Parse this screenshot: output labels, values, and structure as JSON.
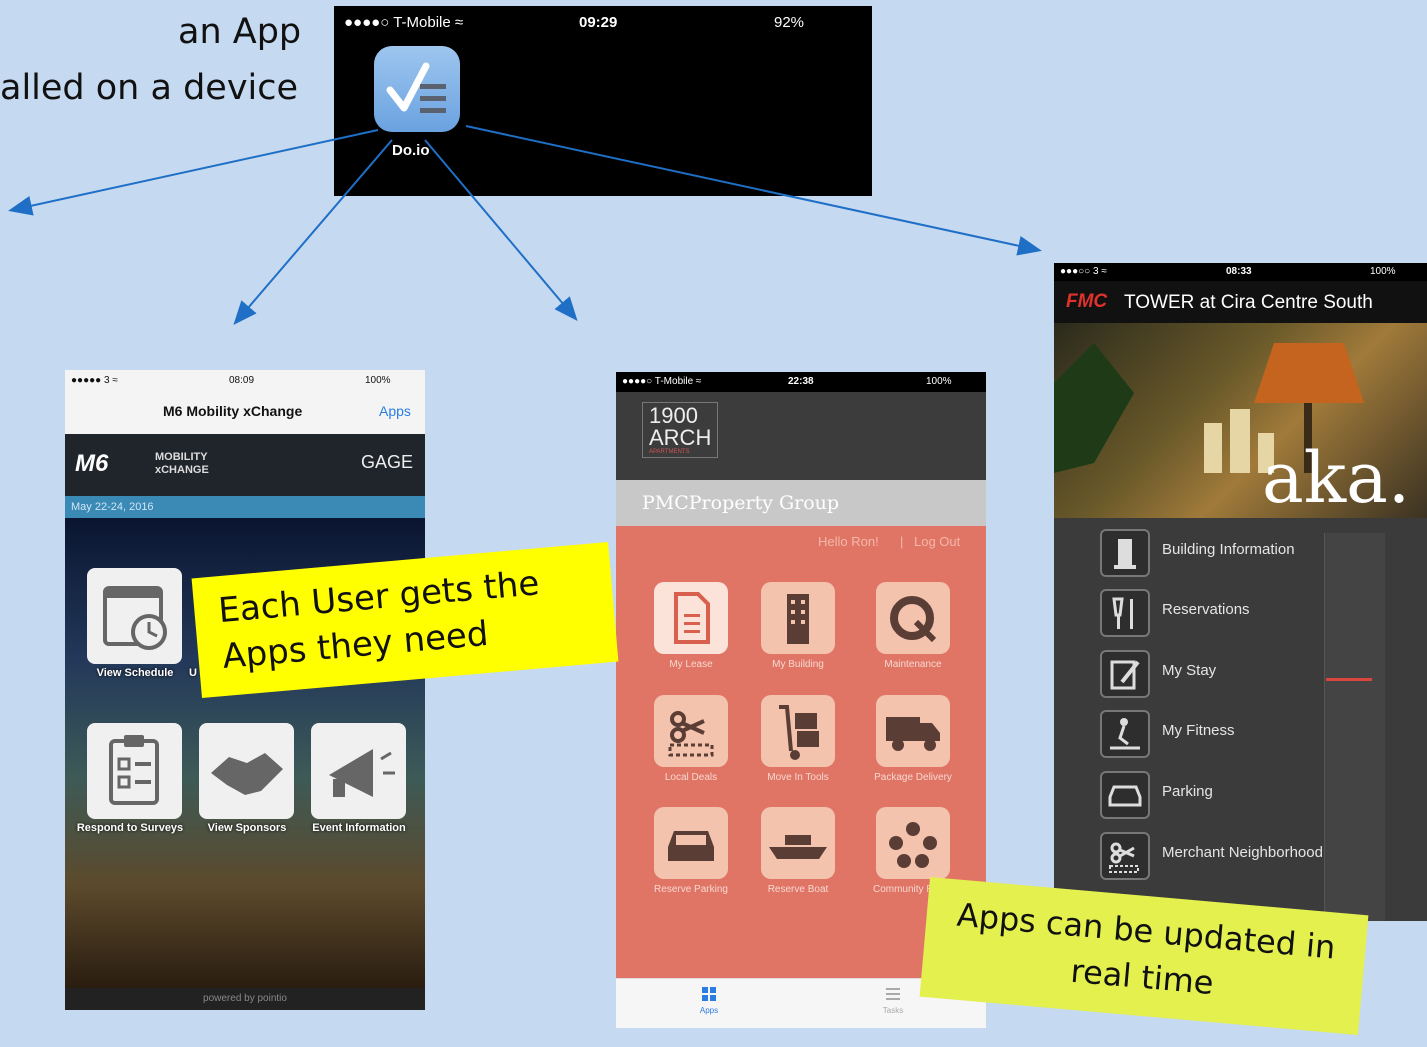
{
  "caption": {
    "line1": "an App",
    "line2": "alled on a device"
  },
  "top_phone": {
    "carrier": "●●●●○ T-Mobile ≈",
    "time": "09:29",
    "battery": "92%",
    "app_label": "Do.io"
  },
  "phone1": {
    "status_left": "●●●●● 3 ≈",
    "status_time": "08:09",
    "status_right": "100%",
    "nav_title": "M6 Mobility xChange",
    "nav_apps": "Apps",
    "brand": "M6",
    "brand_sub1": "MOBILITY",
    "brand_sub2": "xCHANGE",
    "gage": "GAGE",
    "date": "May 22-24, 2016",
    "tiles": [
      {
        "label": "View Schedule"
      },
      {
        "label": "U"
      },
      {
        "label": "Respond to Surveys"
      },
      {
        "label": "View Sponsors"
      },
      {
        "label": "Event Information"
      }
    ],
    "footer": "powered by pointio"
  },
  "phone2": {
    "status_left": "●●●●○ T-Mobile ≈",
    "status_time": "22:38",
    "status_right": "100%",
    "logo_line1": "1900",
    "logo_line2": "ARCH",
    "logo_sub": "APARTMENTS",
    "pmc": "PMCProperty Group",
    "hello": "Hello Ron!",
    "separator": "|",
    "logout": "Log Out",
    "tiles": [
      {
        "label": "My Lease"
      },
      {
        "label": "My Building"
      },
      {
        "label": "Maintenance"
      },
      {
        "label": "Local Deals"
      },
      {
        "label": "Move In Tools"
      },
      {
        "label": "Package Delivery"
      },
      {
        "label": "Reserve Parking"
      },
      {
        "label": "Reserve Boat"
      },
      {
        "label": "Community Room"
      }
    ],
    "tab_apps": "Apps",
    "tab_tasks": "Tasks"
  },
  "phone3": {
    "status_left": "●●●○○ 3 ≈",
    "status_time": "08:33",
    "status_right": "100%",
    "title_brand": "FMC",
    "title_rest": "TOWER at Cira Centre South",
    "hero_text": "aka.",
    "items": [
      {
        "label": "Building Information"
      },
      {
        "label": "Reservations"
      },
      {
        "label": "My Stay"
      },
      {
        "label": "My Fitness"
      },
      {
        "label": "Parking"
      },
      {
        "label": "Merchant Neighborhood"
      }
    ]
  },
  "callouts": {
    "each_user": "Each User gets the Apps they need",
    "updated": "Apps can be updated in real time"
  },
  "colors": {
    "background": "#c5d9f1",
    "arrow": "#1f6fc6",
    "callout1": "#ffff00",
    "callout2": "#e4f04e"
  }
}
